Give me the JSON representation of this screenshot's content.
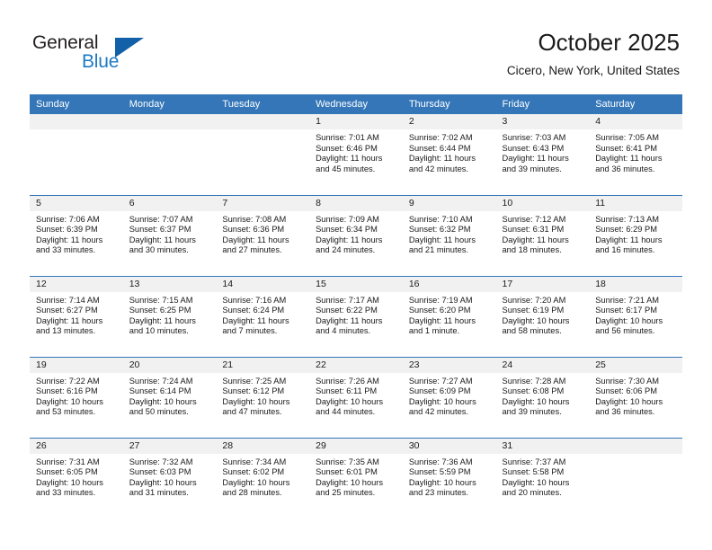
{
  "brand": {
    "word1": "General",
    "word2": "Blue",
    "logo_icon": "triangle-logo-icon",
    "colors": {
      "dark": "#231f20",
      "blue": "#1d7ac4",
      "triangle": "#1160a8"
    }
  },
  "header": {
    "title": "October 2025",
    "subtitle": "Cicero, New York, United States"
  },
  "theme": {
    "header_row_bg": "#3476b8",
    "daynum_band_bg": "#f1f1f1",
    "row_separator": "#3476b8"
  },
  "columns": [
    "Sunday",
    "Monday",
    "Tuesday",
    "Wednesday",
    "Thursday",
    "Friday",
    "Saturday"
  ],
  "weeks": [
    [
      {
        "day": "",
        "blank": true
      },
      {
        "day": "",
        "blank": true
      },
      {
        "day": "",
        "blank": true
      },
      {
        "day": "1",
        "sunrise": "Sunrise: 7:01 AM",
        "sunset": "Sunset: 6:46 PM",
        "daylight1": "Daylight: 11 hours",
        "daylight2": "and 45 minutes."
      },
      {
        "day": "2",
        "sunrise": "Sunrise: 7:02 AM",
        "sunset": "Sunset: 6:44 PM",
        "daylight1": "Daylight: 11 hours",
        "daylight2": "and 42 minutes."
      },
      {
        "day": "3",
        "sunrise": "Sunrise: 7:03 AM",
        "sunset": "Sunset: 6:43 PM",
        "daylight1": "Daylight: 11 hours",
        "daylight2": "and 39 minutes."
      },
      {
        "day": "4",
        "sunrise": "Sunrise: 7:05 AM",
        "sunset": "Sunset: 6:41 PM",
        "daylight1": "Daylight: 11 hours",
        "daylight2": "and 36 minutes."
      }
    ],
    [
      {
        "day": "5",
        "sunrise": "Sunrise: 7:06 AM",
        "sunset": "Sunset: 6:39 PM",
        "daylight1": "Daylight: 11 hours",
        "daylight2": "and 33 minutes."
      },
      {
        "day": "6",
        "sunrise": "Sunrise: 7:07 AM",
        "sunset": "Sunset: 6:37 PM",
        "daylight1": "Daylight: 11 hours",
        "daylight2": "and 30 minutes."
      },
      {
        "day": "7",
        "sunrise": "Sunrise: 7:08 AM",
        "sunset": "Sunset: 6:36 PM",
        "daylight1": "Daylight: 11 hours",
        "daylight2": "and 27 minutes."
      },
      {
        "day": "8",
        "sunrise": "Sunrise: 7:09 AM",
        "sunset": "Sunset: 6:34 PM",
        "daylight1": "Daylight: 11 hours",
        "daylight2": "and 24 minutes."
      },
      {
        "day": "9",
        "sunrise": "Sunrise: 7:10 AM",
        "sunset": "Sunset: 6:32 PM",
        "daylight1": "Daylight: 11 hours",
        "daylight2": "and 21 minutes."
      },
      {
        "day": "10",
        "sunrise": "Sunrise: 7:12 AM",
        "sunset": "Sunset: 6:31 PM",
        "daylight1": "Daylight: 11 hours",
        "daylight2": "and 18 minutes."
      },
      {
        "day": "11",
        "sunrise": "Sunrise: 7:13 AM",
        "sunset": "Sunset: 6:29 PM",
        "daylight1": "Daylight: 11 hours",
        "daylight2": "and 16 minutes."
      }
    ],
    [
      {
        "day": "12",
        "sunrise": "Sunrise: 7:14 AM",
        "sunset": "Sunset: 6:27 PM",
        "daylight1": "Daylight: 11 hours",
        "daylight2": "and 13 minutes."
      },
      {
        "day": "13",
        "sunrise": "Sunrise: 7:15 AM",
        "sunset": "Sunset: 6:25 PM",
        "daylight1": "Daylight: 11 hours",
        "daylight2": "and 10 minutes."
      },
      {
        "day": "14",
        "sunrise": "Sunrise: 7:16 AM",
        "sunset": "Sunset: 6:24 PM",
        "daylight1": "Daylight: 11 hours",
        "daylight2": "and 7 minutes."
      },
      {
        "day": "15",
        "sunrise": "Sunrise: 7:17 AM",
        "sunset": "Sunset: 6:22 PM",
        "daylight1": "Daylight: 11 hours",
        "daylight2": "and 4 minutes."
      },
      {
        "day": "16",
        "sunrise": "Sunrise: 7:19 AM",
        "sunset": "Sunset: 6:20 PM",
        "daylight1": "Daylight: 11 hours",
        "daylight2": "and 1 minute."
      },
      {
        "day": "17",
        "sunrise": "Sunrise: 7:20 AM",
        "sunset": "Sunset: 6:19 PM",
        "daylight1": "Daylight: 10 hours",
        "daylight2": "and 58 minutes."
      },
      {
        "day": "18",
        "sunrise": "Sunrise: 7:21 AM",
        "sunset": "Sunset: 6:17 PM",
        "daylight1": "Daylight: 10 hours",
        "daylight2": "and 56 minutes."
      }
    ],
    [
      {
        "day": "19",
        "sunrise": "Sunrise: 7:22 AM",
        "sunset": "Sunset: 6:16 PM",
        "daylight1": "Daylight: 10 hours",
        "daylight2": "and 53 minutes."
      },
      {
        "day": "20",
        "sunrise": "Sunrise: 7:24 AM",
        "sunset": "Sunset: 6:14 PM",
        "daylight1": "Daylight: 10 hours",
        "daylight2": "and 50 minutes."
      },
      {
        "day": "21",
        "sunrise": "Sunrise: 7:25 AM",
        "sunset": "Sunset: 6:12 PM",
        "daylight1": "Daylight: 10 hours",
        "daylight2": "and 47 minutes."
      },
      {
        "day": "22",
        "sunrise": "Sunrise: 7:26 AM",
        "sunset": "Sunset: 6:11 PM",
        "daylight1": "Daylight: 10 hours",
        "daylight2": "and 44 minutes."
      },
      {
        "day": "23",
        "sunrise": "Sunrise: 7:27 AM",
        "sunset": "Sunset: 6:09 PM",
        "daylight1": "Daylight: 10 hours",
        "daylight2": "and 42 minutes."
      },
      {
        "day": "24",
        "sunrise": "Sunrise: 7:28 AM",
        "sunset": "Sunset: 6:08 PM",
        "daylight1": "Daylight: 10 hours",
        "daylight2": "and 39 minutes."
      },
      {
        "day": "25",
        "sunrise": "Sunrise: 7:30 AM",
        "sunset": "Sunset: 6:06 PM",
        "daylight1": "Daylight: 10 hours",
        "daylight2": "and 36 minutes."
      }
    ],
    [
      {
        "day": "26",
        "sunrise": "Sunrise: 7:31 AM",
        "sunset": "Sunset: 6:05 PM",
        "daylight1": "Daylight: 10 hours",
        "daylight2": "and 33 minutes."
      },
      {
        "day": "27",
        "sunrise": "Sunrise: 7:32 AM",
        "sunset": "Sunset: 6:03 PM",
        "daylight1": "Daylight: 10 hours",
        "daylight2": "and 31 minutes."
      },
      {
        "day": "28",
        "sunrise": "Sunrise: 7:34 AM",
        "sunset": "Sunset: 6:02 PM",
        "daylight1": "Daylight: 10 hours",
        "daylight2": "and 28 minutes."
      },
      {
        "day": "29",
        "sunrise": "Sunrise: 7:35 AM",
        "sunset": "Sunset: 6:01 PM",
        "daylight1": "Daylight: 10 hours",
        "daylight2": "and 25 minutes."
      },
      {
        "day": "30",
        "sunrise": "Sunrise: 7:36 AM",
        "sunset": "Sunset: 5:59 PM",
        "daylight1": "Daylight: 10 hours",
        "daylight2": "and 23 minutes."
      },
      {
        "day": "31",
        "sunrise": "Sunrise: 7:37 AM",
        "sunset": "Sunset: 5:58 PM",
        "daylight1": "Daylight: 10 hours",
        "daylight2": "and 20 minutes."
      },
      {
        "day": "",
        "blank": true
      }
    ]
  ]
}
